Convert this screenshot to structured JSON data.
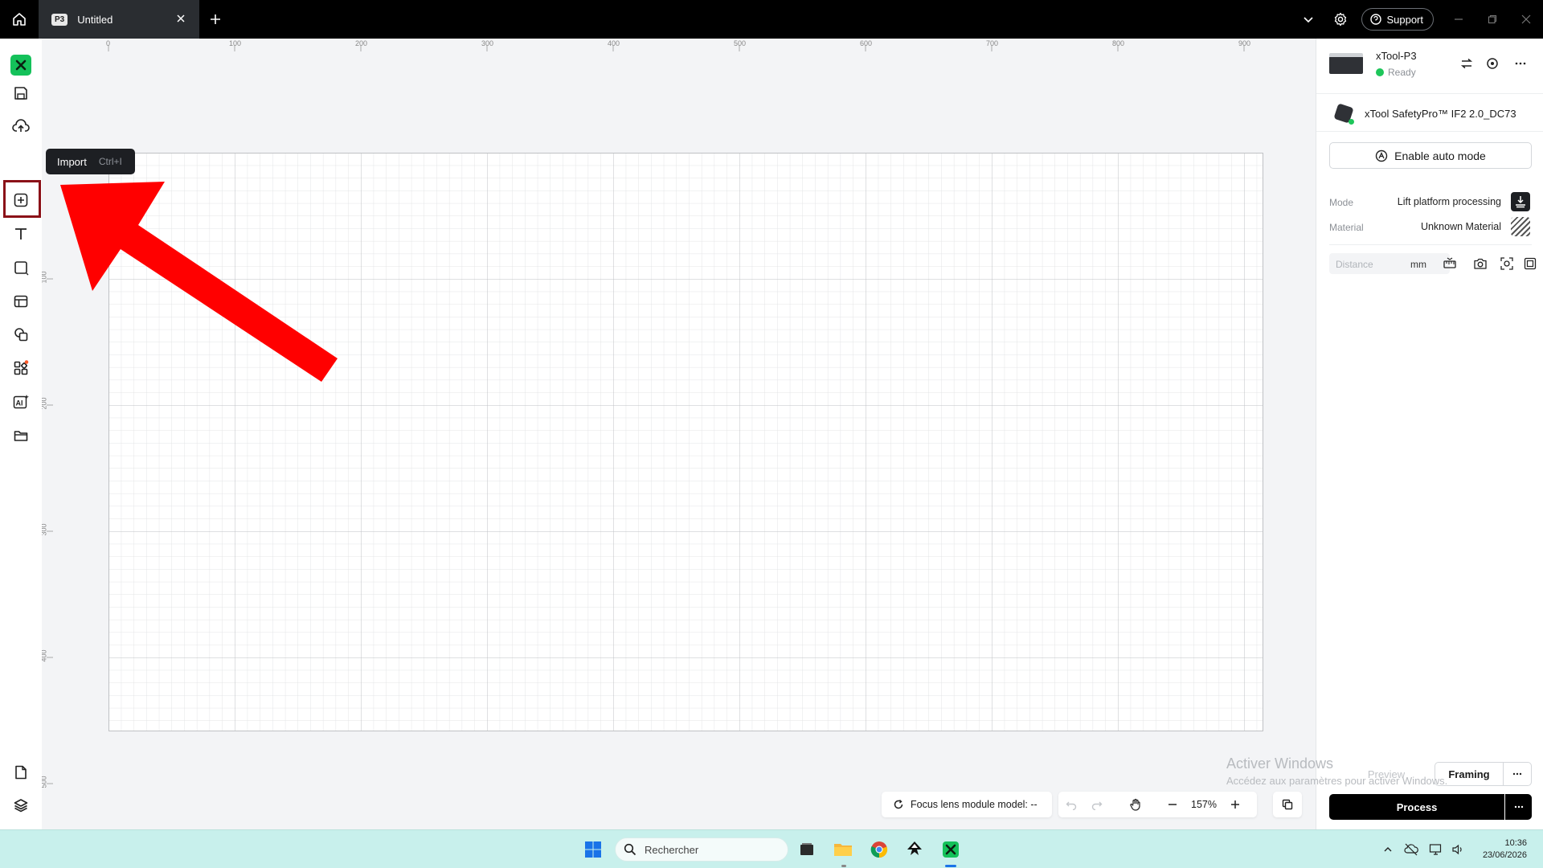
{
  "titlebar": {
    "tab_badge": "P3",
    "tab_title": "Untitled",
    "support_label": "Support"
  },
  "tooltip": {
    "label": "Import",
    "shortcut": "Ctrl+I"
  },
  "rulers": {
    "horizontal": [
      "0",
      "100",
      "200",
      "300",
      "400",
      "500",
      "600",
      "700",
      "800",
      "900"
    ],
    "vertical": [
      "100",
      "200",
      "300",
      "400",
      "500"
    ]
  },
  "device": {
    "name": "xTool-P3",
    "status": "Ready",
    "safety_name": "xTool SafetyPro™ IF2 2.0_DC73",
    "auto_mode_label": "Enable auto mode",
    "mode_label": "Mode",
    "mode_value": "Lift platform processing",
    "material_label": "Material",
    "material_value": "Unknown Material",
    "distance_placeholder": "Distance",
    "distance_unit": "mm"
  },
  "actions": {
    "preview_label": "Preview",
    "framing_label": "Framing",
    "process_label": "Process"
  },
  "bottombar": {
    "focus_label": "Focus lens module model: --",
    "zoom": "157%"
  },
  "watermark": {
    "title": "Activer Windows",
    "subtitle": "Accédez aux paramètres pour activer Windows."
  },
  "taskbar": {
    "search_placeholder": "Rechercher",
    "time": "10:36",
    "date": "23/06/2026"
  },
  "colors": {
    "accent_green": "#14c15a",
    "highlight_red": "#8b1118",
    "arrow_red": "#ff0000",
    "taskbar_bg": "#c8f0ec"
  }
}
